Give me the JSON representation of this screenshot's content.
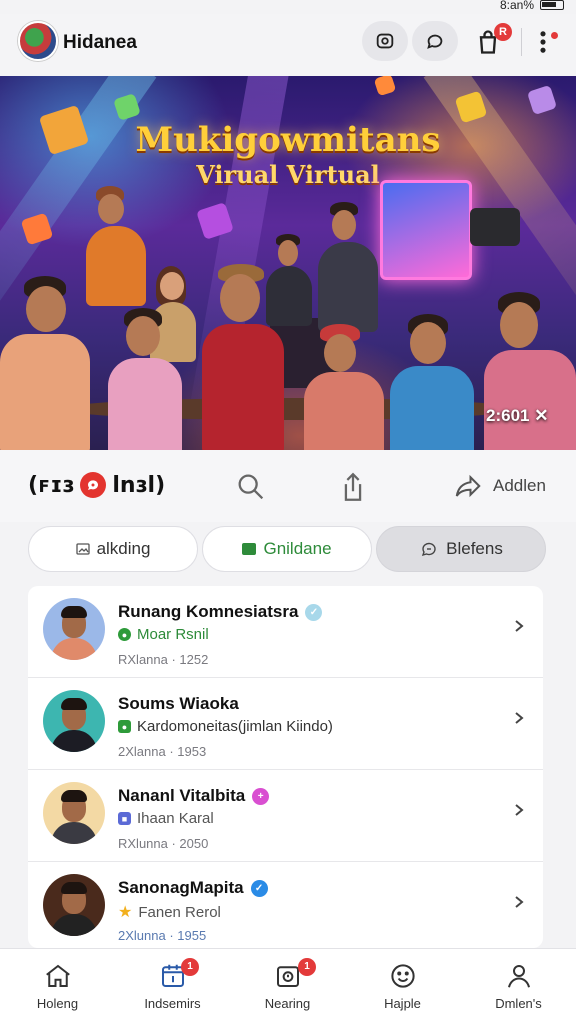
{
  "status_bar": {
    "text": "8:an%"
  },
  "header": {
    "title": "Hidanea",
    "badge_count": "R",
    "icons": [
      "camera-icon",
      "chat-bubble-icon",
      "bag-icon",
      "more-vertical-icon"
    ]
  },
  "banner": {
    "title": "Mukigowmitans",
    "subtitle": "Virual Virtual",
    "counter": "2:601 ✕"
  },
  "actions": {
    "left_label_1": "(ꜰɪɜ",
    "left_label_2": "lnɜl)",
    "add_label": "Addlen"
  },
  "chips": [
    {
      "label": "alkding",
      "icon": "image-icon"
    },
    {
      "label": "Gnildane",
      "icon": "green-square-icon"
    },
    {
      "label": "Blefens",
      "icon": "chat-icon"
    }
  ],
  "list": [
    {
      "name": "Runang Komnesiatsra",
      "verified_color": "#a8d8ea",
      "sub": "Moar Rsnil",
      "sub_color": "#2e8b3a",
      "sub_icon_color": "#2e9b3a",
      "meta": "RXlanna · 1252",
      "avatar_bg": "#9bb8e8",
      "suit": "#e08a6a"
    },
    {
      "name": "Soums Wiaoka",
      "verified_color": "",
      "sub": "Kardomoneitas(jimlan Kiindo)",
      "sub_color": "#333",
      "sub_icon_color": "#2e9b3a",
      "meta": "2Xlanna · 1953",
      "avatar_bg": "#3db6b0",
      "suit": "#1c1c24"
    },
    {
      "name": "Nananl Vitalbita",
      "verified_color": "#d94fd1",
      "sub": "Ihaan Karal",
      "sub_color": "#555",
      "sub_icon_color": "#5b6ad6",
      "meta": "RXlunna · 2050",
      "avatar_bg": "#f3d9a4",
      "suit": "#3a3a42"
    },
    {
      "name": "SanonagMapita",
      "verified_color": "#2a8be6",
      "sub": "Fanen Rerol",
      "sub_color": "#555",
      "sub_icon_color": "#f2b01e",
      "meta": "2Xlunna · 1955",
      "avatar_bg": "#4a2a1c",
      "suit": "#222"
    }
  ],
  "bottom_nav": [
    {
      "label": "Holeng",
      "icon": "home-icon",
      "badge": ""
    },
    {
      "label": "Indsemirs",
      "icon": "calendar-icon",
      "badge": "1"
    },
    {
      "label": "Nearing",
      "icon": "notification-icon",
      "badge": "1"
    },
    {
      "label": "Hajple",
      "icon": "smile-icon",
      "badge": ""
    },
    {
      "label": "Dmlen's",
      "icon": "profile-icon",
      "badge": ""
    }
  ]
}
